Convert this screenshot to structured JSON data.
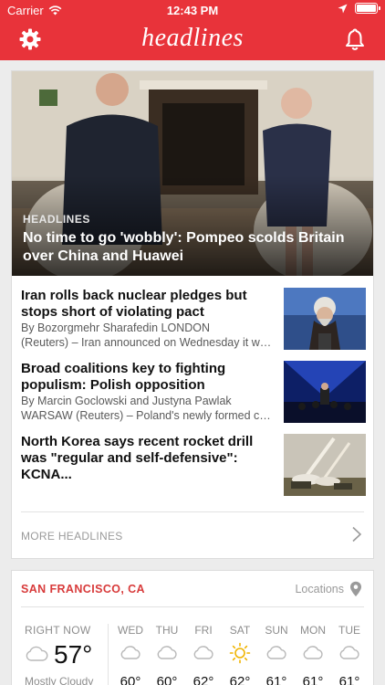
{
  "status_bar": {
    "carrier": "Carrier",
    "time": "12:43 PM"
  },
  "nav": {
    "brand": "headlines",
    "left_icon": "gear-icon",
    "right_icon": "bell-icon"
  },
  "colors": {
    "brand_red": "#e8333a",
    "city_red": "#d83b3b"
  },
  "top_story": {
    "kicker": "HEADLINES",
    "title": "No time to go 'wobbly': Pompeo scolds Britain over China and Huawei"
  },
  "stories": [
    {
      "headline": "Iran rolls back nuclear pledges but stops short of violating pact",
      "byline_1": "By Bozorgmehr Sharafedin LONDON",
      "byline_2": "(Reuters) – Iran announced on Wednesday it would"
    },
    {
      "headline": "Broad coalitions key to fighting populism: Polish opposition",
      "byline_1": "By Marcin Goclowski and Justyna Pawlak",
      "byline_2": "WARSAW (Reuters) – Poland's newly formed coalition"
    },
    {
      "headline": "North Korea says recent rocket drill was \"regular and self-defensive\": KCNA...",
      "byline_1": "",
      "byline_2": ""
    }
  ],
  "more": {
    "label": "MORE HEADLINES"
  },
  "weather": {
    "city": "SAN FRANCISCO, CA",
    "locations_label": "Locations",
    "now_label": "RIGHT NOW",
    "now_temp": "57°",
    "now_condition": "Mostly Cloudy",
    "days": [
      {
        "name": "WED",
        "icon": "cloud-icon",
        "temp": "60°"
      },
      {
        "name": "THU",
        "icon": "cloud-icon",
        "temp": "60°"
      },
      {
        "name": "FRI",
        "icon": "cloud-icon",
        "temp": "62°"
      },
      {
        "name": "SAT",
        "icon": "sun-icon",
        "temp": "62°"
      },
      {
        "name": "SUN",
        "icon": "cloud-icon",
        "temp": "61°"
      },
      {
        "name": "MON",
        "icon": "cloud-icon",
        "temp": "61°"
      },
      {
        "name": "TUE",
        "icon": "cloud-icon",
        "temp": "61°"
      }
    ]
  }
}
